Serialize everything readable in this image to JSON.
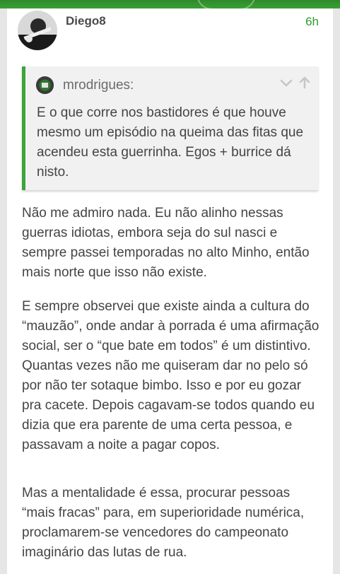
{
  "post": {
    "username": "Diego8",
    "time": "6h",
    "quote": {
      "author": "mrodrigues:",
      "text": "E o que corre nos bastidores é que houve mesmo um episódio na queima das fitas que acendeu esta guerrinha. Egos + burrice dá nisto."
    },
    "paragraphs": [
      "Não me admiro nada. Eu não alinho nessas guerras idiotas, embora seja do sul nasci e sempre passei temporadas no alto Minho, então mais norte que isso não existe.",
      "E sempre observei que existe ainda a cultura do “mauzão”, onde andar à porrada é uma afirmação social, ser o “que bate em todos” é um distintivo. Quantas vezes não me quiseram dar no pelo só por não ter sotaque bimbo. Isso e por eu gozar pra cacete. Depois cagavam-se todos quando eu dizia que era parente de uma certa pessoa, e passavam a noite a pagar copos.",
      "Mas a mentalidade é essa, procurar pessoas “mais fracas” para, em superioridade numérica, proclamarem-se vencedores do campeonato imaginário das lutas de rua."
    ]
  },
  "icons": {
    "expand": "chevron-down-icon",
    "go_to_quote": "arrow-up-icon"
  },
  "colors": {
    "accent": "#3ea33a",
    "time": "#2f9a2c",
    "text": "#444444",
    "quote_bg": "#f1f1f1",
    "page_bg": "#e6e6e6"
  }
}
